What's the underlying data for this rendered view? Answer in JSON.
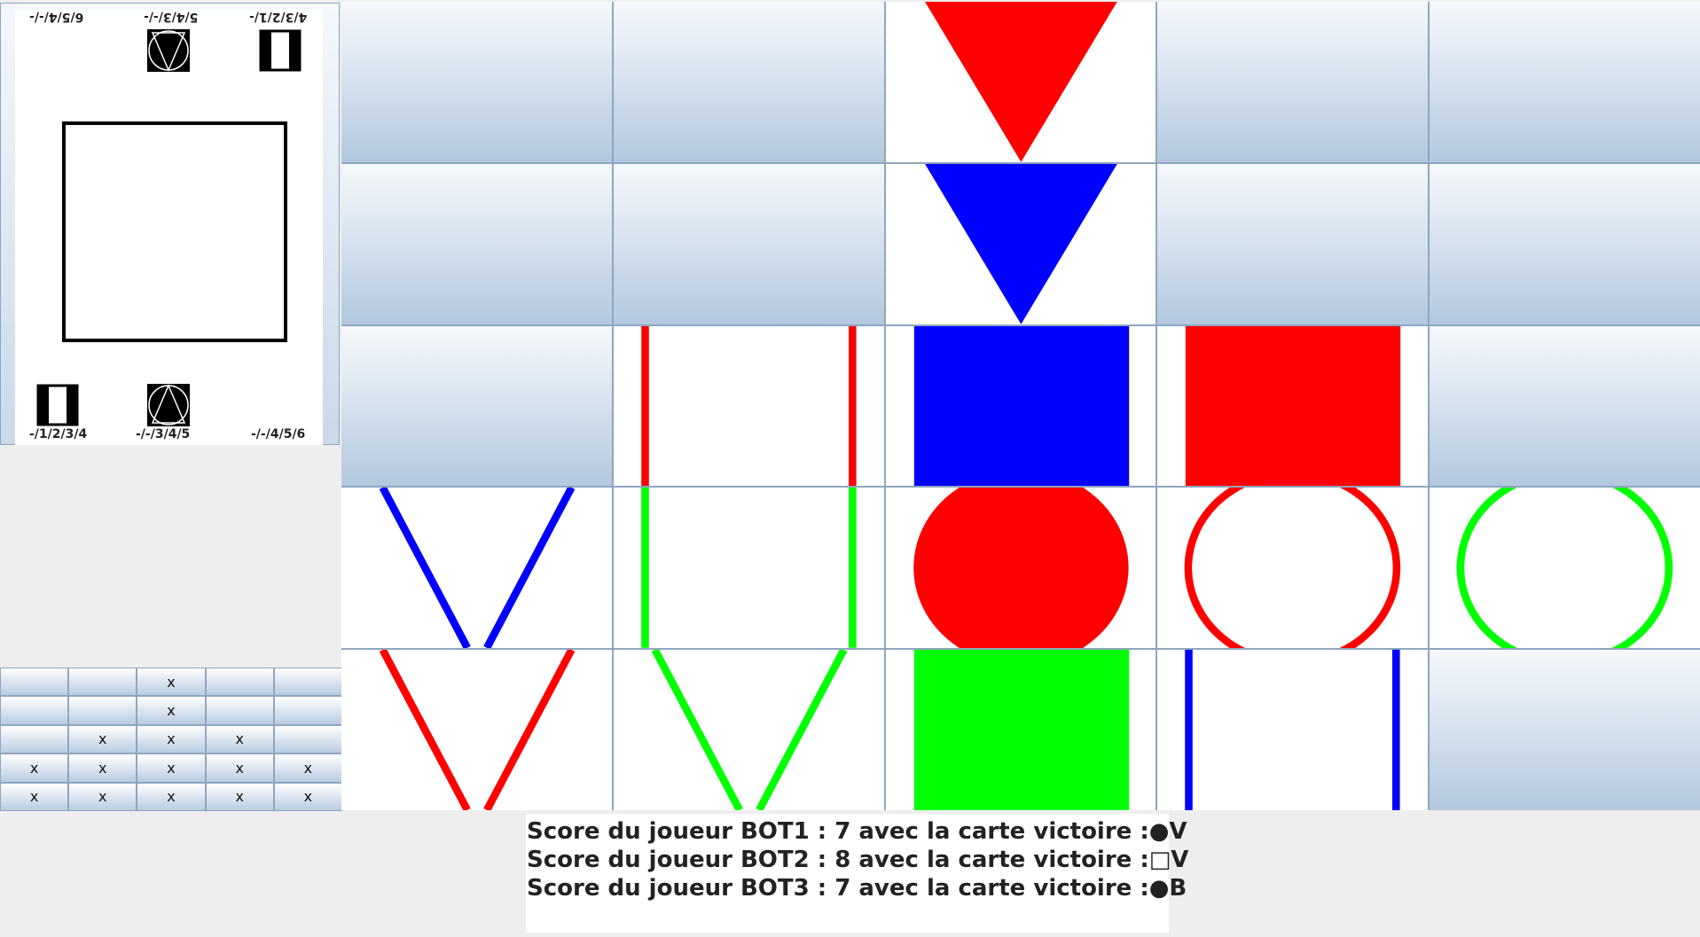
{
  "preview_card": {
    "top_left_text": "6/5/4/-/-",
    "top_mid_text": "5/4/3/-/-",
    "top_right_text": "4/3/2/1/-",
    "bottom_left_text": "-/1/2/3/4",
    "bottom_mid_text": "-/-/3/4/5",
    "bottom_right_text": "-/-/4/5/6",
    "icons": [
      "half-filled-rectangle-icon",
      "triangle-in-circle-icon"
    ]
  },
  "mini_grid": {
    "rows": [
      [
        "",
        "",
        "x",
        "",
        ""
      ],
      [
        "",
        "",
        "x",
        "",
        ""
      ],
      [
        "",
        "x",
        "x",
        "x",
        ""
      ],
      [
        "x",
        "x",
        "x",
        "x",
        "x"
      ],
      [
        "x",
        "x",
        "x",
        "x",
        "x"
      ]
    ]
  },
  "board": {
    "rows": [
      [
        null,
        null,
        {
          "shape": "triangle",
          "fill": "filled",
          "color": "#ff0000"
        },
        null,
        null
      ],
      [
        null,
        null,
        {
          "shape": "triangle",
          "fill": "filled",
          "color": "#0000ff"
        },
        null,
        null
      ],
      [
        null,
        {
          "shape": "square",
          "fill": "outline",
          "color": "#ff0000"
        },
        {
          "shape": "square",
          "fill": "filled",
          "color": "#0000ff"
        },
        {
          "shape": "square",
          "fill": "filled",
          "color": "#ff0000"
        },
        null
      ],
      [
        {
          "shape": "triangle",
          "fill": "outline",
          "color": "#0000ff"
        },
        {
          "shape": "square",
          "fill": "outline",
          "color": "#00ff00"
        },
        {
          "shape": "circle",
          "fill": "filled",
          "color": "#ff0000"
        },
        {
          "shape": "circle",
          "fill": "outline",
          "color": "#ff0000"
        },
        {
          "shape": "circle",
          "fill": "outline",
          "color": "#00ff00"
        }
      ],
      [
        {
          "shape": "triangle",
          "fill": "outline",
          "color": "#ff0000"
        },
        {
          "shape": "triangle",
          "fill": "outline",
          "color": "#00ff00"
        },
        {
          "shape": "square",
          "fill": "filled",
          "color": "#00ff00"
        },
        {
          "shape": "square",
          "fill": "outline",
          "color": "#0000ff"
        },
        null
      ]
    ]
  },
  "scores": [
    "Score du joueur BOT1 : 7 avec la carte victoire :●V",
    "Score du joueur BOT2 : 8 avec la carte victoire :□V",
    "Score du joueur BOT3 : 7 avec la carte victoire :●B"
  ]
}
